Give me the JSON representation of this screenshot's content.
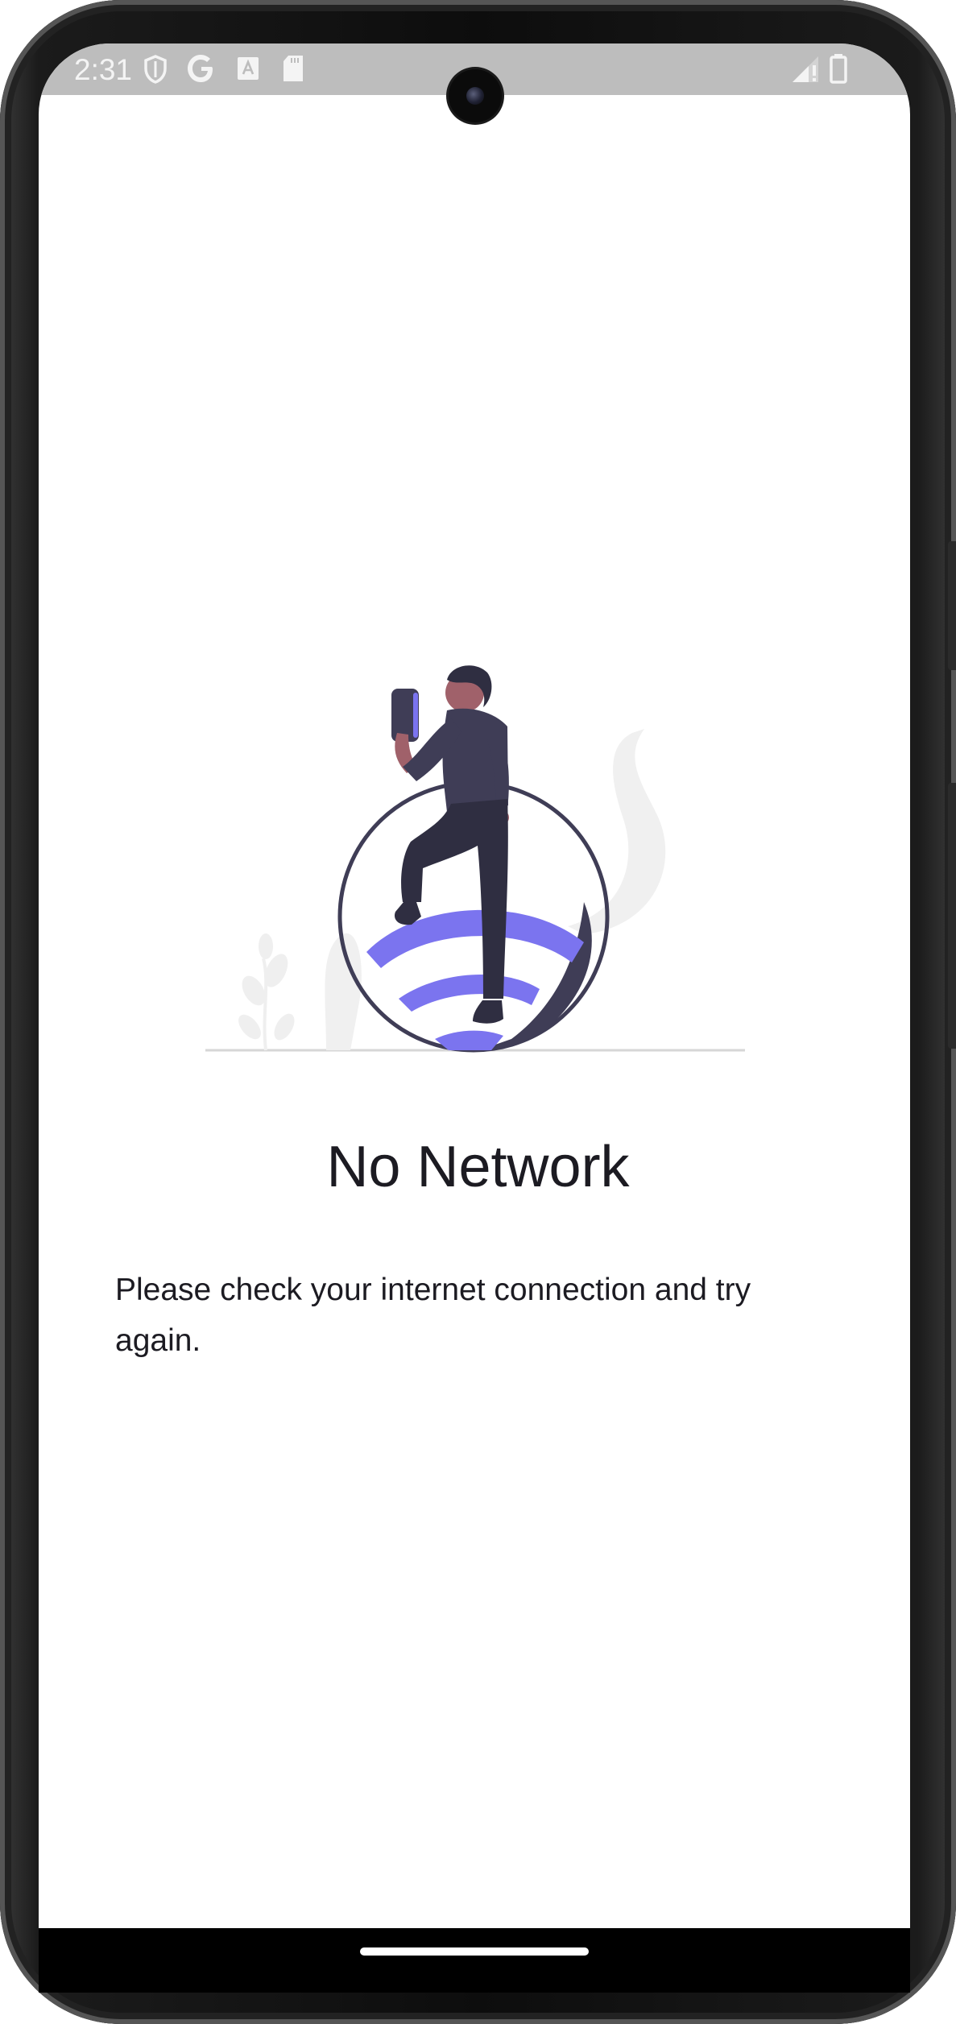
{
  "status_bar": {
    "time": "2:31",
    "left_icons": [
      "shield-icon",
      "google-icon",
      "font-icon",
      "sd-card-icon"
    ],
    "right_icons": [
      "signal-icon",
      "battery-icon"
    ]
  },
  "empty_state": {
    "title": "No Network",
    "message": "Please check your internet connection and try again.",
    "illustration": "person-with-wifi-illustration"
  },
  "colors": {
    "accent": "#7b74ef",
    "text": "#1c1b22",
    "figure": "#3f3d56",
    "status_bar": "#bdbdbd"
  }
}
